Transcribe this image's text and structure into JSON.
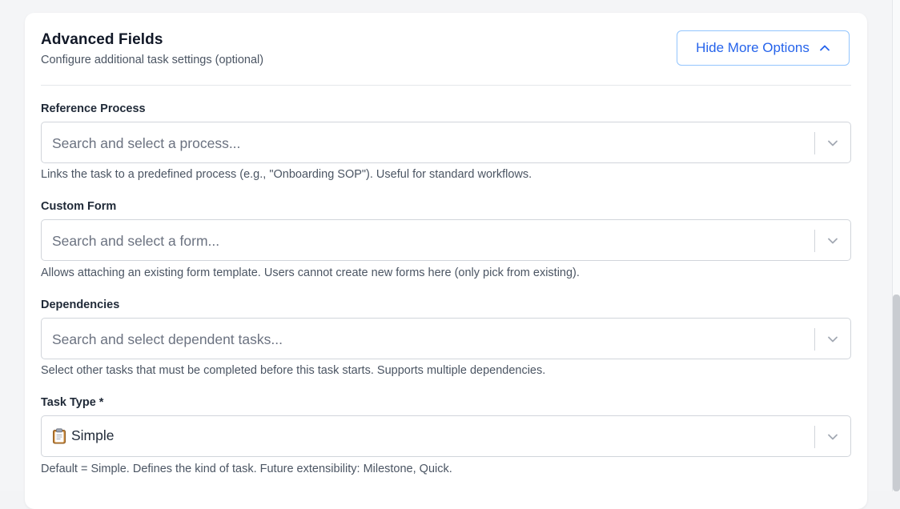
{
  "section": {
    "title": "Advanced Fields",
    "subtitle": "Configure additional task settings (optional)",
    "toggle_label": "Hide More Options",
    "toggle_icon": "chevron-up-icon"
  },
  "fields": {
    "reference_process": {
      "label": "Reference Process",
      "placeholder": "Search and select a process...",
      "help": "Links the task to a predefined process (e.g., \"Onboarding SOP\"). Useful for standard workflows."
    },
    "custom_form": {
      "label": "Custom Form",
      "placeholder": "Search and select a form...",
      "help": "Allows attaching an existing form template. Users cannot create new forms here (only pick from existing)."
    },
    "dependencies": {
      "label": "Dependencies",
      "placeholder": "Search and select dependent tasks...",
      "help": "Select other tasks that must be completed before this task starts. Supports multiple dependencies."
    },
    "task_type": {
      "label": "Task Type *",
      "value": "Simple",
      "value_icon": "clipboard-icon",
      "help": "Default = Simple. Defines the kind of task. Future extensibility: Milestone, Quick."
    }
  },
  "colors": {
    "accent": "#2563eb",
    "accent_border": "#93c5fd",
    "card_bg": "#ffffff",
    "page_bg": "#f4f5f7"
  }
}
